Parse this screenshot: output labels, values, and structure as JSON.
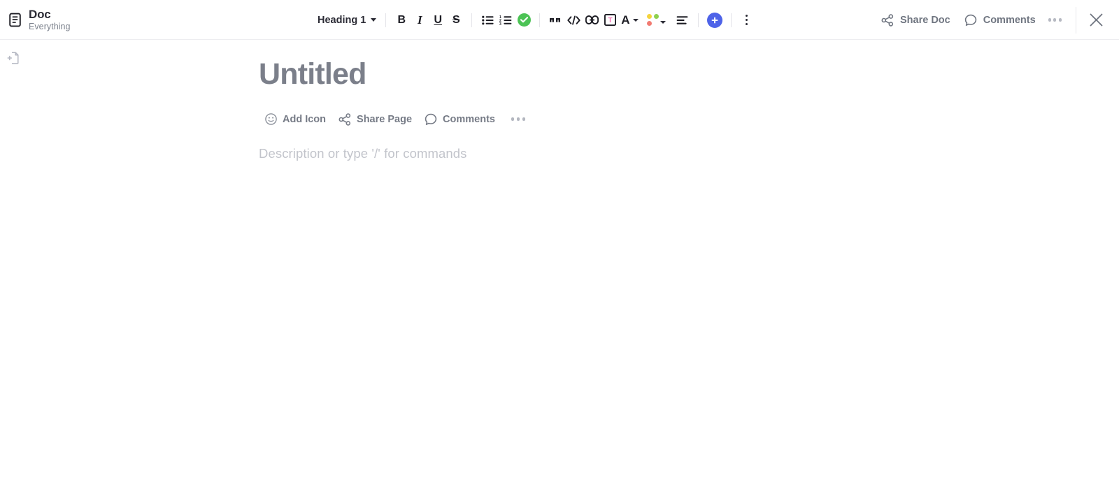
{
  "header": {
    "doc_icon": "document-icon",
    "title": "Doc",
    "subtitle": "Everything",
    "toolbar": {
      "style_select": {
        "label": "Heading 1",
        "icon": "chevron-down-icon"
      },
      "bold": "B",
      "italic": "I",
      "underline": "U",
      "strikethrough": "S",
      "bullet_list": "bullet-list-icon",
      "numbered_list": "numbered-list-icon",
      "checklist": "checklist-icon",
      "quote": "quote-icon",
      "code": "code-icon",
      "link": "link-icon",
      "banner": "banner-text-icon",
      "font_color": "font-color-icon",
      "highlight": "highlight-color-icon",
      "align": "align-left-icon",
      "insert": "add-block-icon",
      "more": "more-vertical-icon"
    },
    "right": {
      "share_doc": "Share Doc",
      "share_icon": "share-icon",
      "comments": "Comments",
      "comments_icon": "comment-icon",
      "more": "more-horizontal-icon",
      "close": "close-icon"
    }
  },
  "rail": {
    "add_page": "add-page-icon"
  },
  "page": {
    "title": "Untitled",
    "actions": [
      {
        "label": "Add Icon",
        "icon": "smiley-icon"
      },
      {
        "label": "Share Page",
        "icon": "share-icon"
      },
      {
        "label": "Comments",
        "icon": "comment-icon"
      }
    ],
    "more": "more-horizontal-icon",
    "description_placeholder": "Description or type '/' for commands"
  },
  "colors": {
    "accent_blue": "#4e63e8",
    "check_green": "#4cc355",
    "dot_yellow": "#f5d33d",
    "dot_green": "#8fd14f",
    "dot_red": "#f27b72",
    "banner_pink": "#f472b6",
    "text_dark": "#2b2b35",
    "text_muted": "#7c828d",
    "placeholder": "#c2c4cb"
  }
}
